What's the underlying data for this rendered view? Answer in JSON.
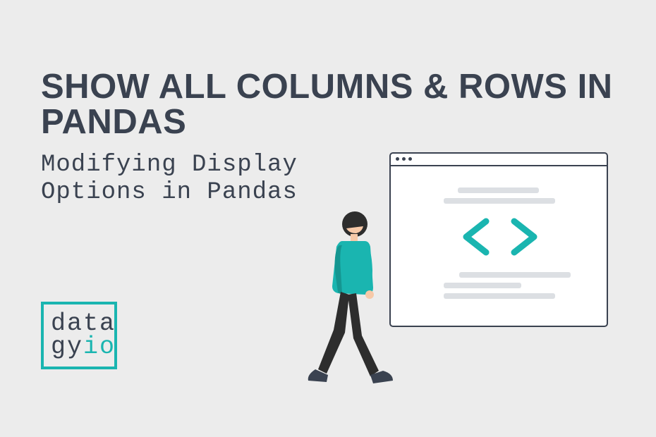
{
  "title": "SHOW ALL COLUMNS & ROWS IN PANDAS",
  "subtitle_line1": "Modifying Display",
  "subtitle_line2": "Options in Pandas",
  "logo": {
    "line1": "data",
    "line2_part1": "gy",
    "line2_part2": "io"
  },
  "colors": {
    "accent": "#1ab5b0",
    "text": "#3a4250",
    "bg": "#ececec"
  }
}
